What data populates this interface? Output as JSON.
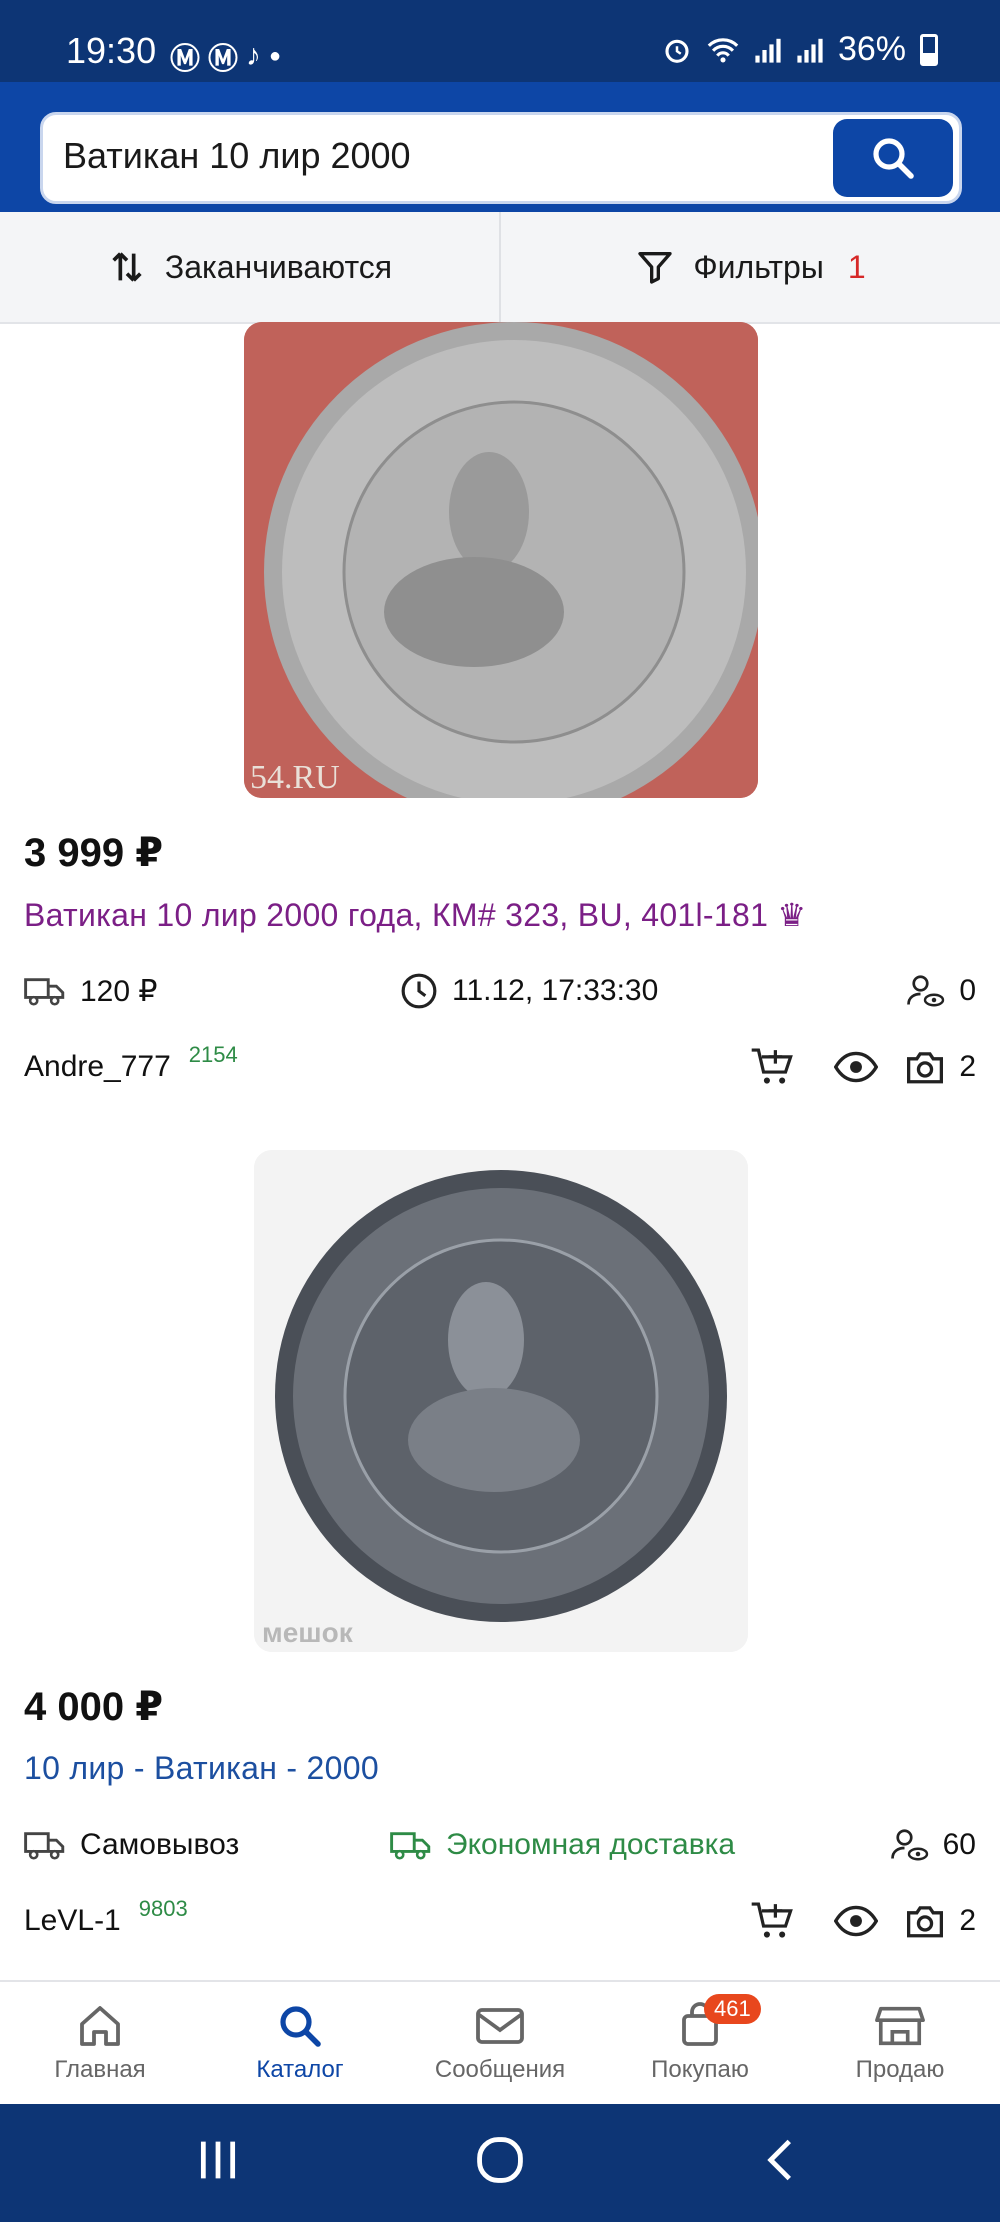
{
  "status_bar": {
    "time": "19:30",
    "battery": "36%",
    "left_icons": [
      "metro-icon",
      "metro-icon",
      "tiktok-icon",
      "dot-icon"
    ],
    "right_icons": [
      "alarm-icon",
      "wifi-icon",
      "signal-icon",
      "signal-icon",
      "battery-icon"
    ]
  },
  "search": {
    "query": "Ватикан 10 лир 2000"
  },
  "toolbar": {
    "sort_label": "Заканчиваются",
    "filter_label": "Фильтры",
    "filter_count": "1"
  },
  "listings": [
    {
      "price": "3 999 ₽",
      "title": "Ватикан 10 лир 2000 года, КМ# 323, BU, 401l-181 ♛",
      "title_color": "#7b1f86",
      "delivery": "120 ₽",
      "end_time": "11.12, 17:33:30",
      "watchers": "0",
      "seller": "Andre_777",
      "seller_rating": "2154",
      "photos": "2",
      "watermark": "54.RU"
    },
    {
      "price": "4 000 ₽",
      "title": "10 лир - Ватикан - 2000",
      "title_color": "#1c4fa0",
      "delivery": "Самовывоз",
      "shipping_option": "Экономная доставка",
      "watchers": "60",
      "seller": "LeVL-1",
      "seller_rating": "9803",
      "photos": "2",
      "watermark": "мешок"
    }
  ],
  "bottom_nav": [
    {
      "label": "Главная",
      "icon": "home-icon"
    },
    {
      "label": "Каталог",
      "icon": "search-icon",
      "active": true
    },
    {
      "label": "Сообщения",
      "icon": "mail-icon"
    },
    {
      "label": "Покупаю",
      "icon": "bag-icon",
      "badge": "461"
    },
    {
      "label": "Продаю",
      "icon": "store-icon"
    }
  ],
  "android_nav": [
    "recents-icon",
    "home-circle-icon",
    "back-icon"
  ],
  "colors": {
    "brand": "#0d46a6",
    "status_bar": "#0d3575",
    "accent_red": "#d62828",
    "green": "#2e8b46"
  }
}
